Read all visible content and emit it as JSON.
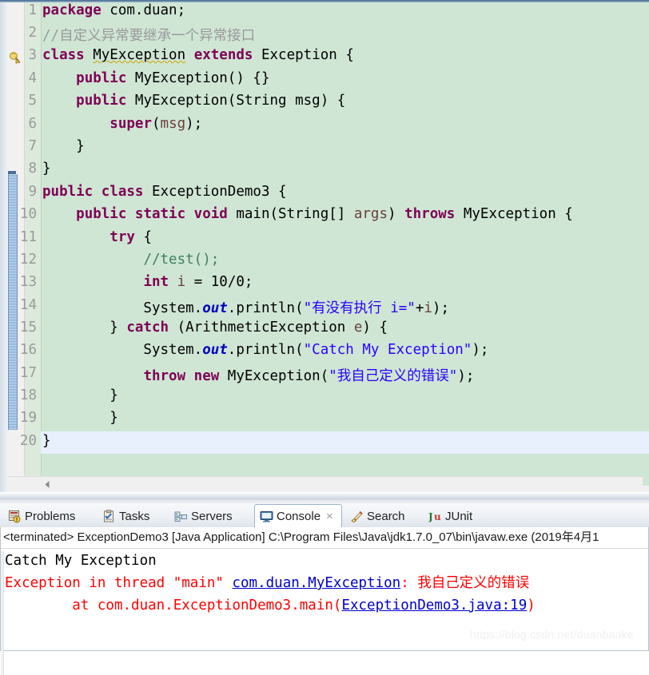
{
  "editor": {
    "name": "java-source-editor",
    "gutter_numbers": [
      "1",
      "2",
      "3",
      "4",
      "5",
      "6",
      "7",
      "8",
      "9",
      "10",
      "11",
      "12",
      "13",
      "14",
      "15",
      "16",
      "17",
      "18",
      "19",
      "20"
    ],
    "warning_marker_tooltip": "warning",
    "lines": [
      {
        "n": "1",
        "text": "package com.duan;"
      },
      {
        "n": "2",
        "text": "//自定义异常要继承一个异常接口"
      },
      {
        "n": "3",
        "text": "class MyException extends Exception {"
      },
      {
        "n": "4",
        "text": "    public MyException() {}"
      },
      {
        "n": "5",
        "text": "    public MyException(String msg) {"
      },
      {
        "n": "6",
        "text": "        super(msg);"
      },
      {
        "n": "7",
        "text": "    }"
      },
      {
        "n": "8",
        "text": "}"
      },
      {
        "n": "9",
        "text": "public class ExceptionDemo3 {"
      },
      {
        "n": "10",
        "text": "    public static void main(String[] args) throws MyException {"
      },
      {
        "n": "11",
        "text": "        try {"
      },
      {
        "n": "12",
        "text": "            //test();"
      },
      {
        "n": "13",
        "text": "            int i = 10/0;"
      },
      {
        "n": "14",
        "text": "            System.out.println(\"有没有执行 i=\"+i);"
      },
      {
        "n": "15",
        "text": "        } catch (ArithmeticException e) {"
      },
      {
        "n": "16",
        "text": "            System.out.println(\"Catch My Exception\");"
      },
      {
        "n": "17",
        "text": "            throw new MyException(\"我自己定义的错误\");"
      },
      {
        "n": "18",
        "text": "        }"
      },
      {
        "n": "19",
        "text": "        }"
      },
      {
        "n": "20",
        "text": "}"
      }
    ],
    "caret_line": "20",
    "scrollbar": {
      "left_arrow": "◀"
    },
    "colors": {
      "background": "#cfe6d4",
      "gutter": "#dceadb",
      "keyword": "#7f0055",
      "string": "#2a00ff",
      "comment": "#3f7f5f",
      "field": "#0000c0",
      "local_var": "#6a3e3e",
      "caret_row": "#e8f0fd"
    }
  },
  "bottom_panel": {
    "tabs": [
      {
        "label": "Problems",
        "icon": "problems-icon",
        "active": false,
        "closable": false
      },
      {
        "label": "Tasks",
        "icon": "tasks-icon",
        "active": false,
        "closable": false
      },
      {
        "label": "Servers",
        "icon": "servers-icon",
        "active": false,
        "closable": false
      },
      {
        "label": "Console",
        "icon": "console-icon",
        "active": true,
        "closable": true
      },
      {
        "label": "Search",
        "icon": "search-icon",
        "active": false,
        "closable": false
      },
      {
        "label": "JUnit",
        "icon": "junit-icon",
        "active": false,
        "closable": false
      }
    ],
    "close_glyph": "×",
    "console": {
      "launch_header": "<terminated> ExceptionDemo3 [Java Application] C:\\Program Files\\Java\\jdk1.7.0_07\\bin\\javaw.exe (2019年4月1",
      "output": [
        {
          "style": "black",
          "segments": [
            {
              "text": "Catch My Exception",
              "link": false
            }
          ]
        },
        {
          "style": "red",
          "segments": [
            {
              "text": "Exception in thread \"main\" ",
              "link": false
            },
            {
              "text": "com.duan.MyException",
              "link": true
            },
            {
              "text": ": 我自己定义的错误",
              "link": false
            }
          ]
        },
        {
          "style": "red",
          "segments": [
            {
              "text": "\tat com.duan.ExceptionDemo3.main(",
              "link": false
            },
            {
              "text": "ExceptionDemo3.java:19",
              "link": true
            },
            {
              "text": ")",
              "link": false
            }
          ]
        }
      ]
    }
  },
  "watermark": {
    "text": "https://blog.csdn.net/duanbaoke"
  }
}
